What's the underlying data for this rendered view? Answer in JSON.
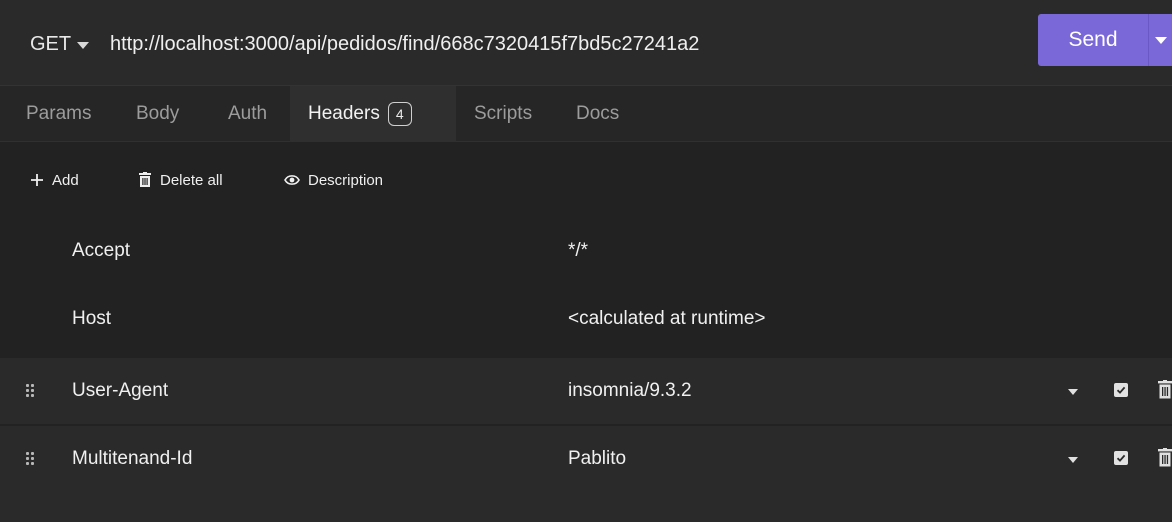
{
  "request": {
    "method": "GET",
    "url": "http://localhost:3000/api/pedidos/find/668c7320415f7bd5c27241a2",
    "send_label": "Send"
  },
  "tabs": [
    {
      "label": "Params"
    },
    {
      "label": "Body"
    },
    {
      "label": "Auth"
    },
    {
      "label": "Headers",
      "badge": "4",
      "active": true
    },
    {
      "label": "Scripts"
    },
    {
      "label": "Docs"
    }
  ],
  "toolbar": {
    "add_label": "Add",
    "delete_all_label": "Delete all",
    "description_label": "Description"
  },
  "headers": [
    {
      "key": "Accept",
      "value": "*/*",
      "editable": false
    },
    {
      "key": "Host",
      "value": "<calculated at runtime>",
      "editable": false
    },
    {
      "key": "User-Agent",
      "value": "insomnia/9.3.2",
      "editable": true,
      "enabled": true
    },
    {
      "key": "Multitenand-Id",
      "value": "Pablito",
      "editable": true,
      "enabled": true
    }
  ],
  "colors": {
    "accent": "#7b68d8",
    "background": "#222222",
    "panel": "#2a2a2a"
  }
}
